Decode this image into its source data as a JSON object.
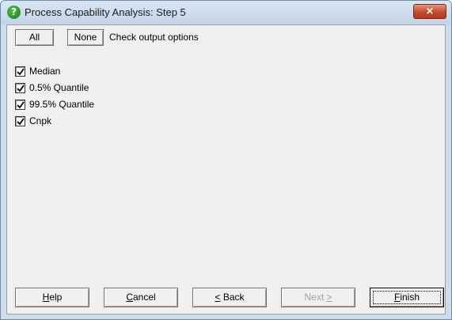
{
  "window": {
    "title": "Process Capability Analysis: Step 5",
    "close_label": "×"
  },
  "toolbar": {
    "all_label": "All",
    "none_label": "None",
    "instruction": "Check output options"
  },
  "options": [
    {
      "label": "Median",
      "checked": true
    },
    {
      "label": "0.5% Quantile",
      "checked": true
    },
    {
      "label": "99.5% Quantile",
      "checked": true
    },
    {
      "label": "Cnpk",
      "checked": true
    }
  ],
  "footer": {
    "help": {
      "prefix": "",
      "key": "H",
      "rest": "elp"
    },
    "cancel": {
      "prefix": "",
      "key": "C",
      "rest": "ancel"
    },
    "back": {
      "prefix": "",
      "key": "<",
      "rest": " Back"
    },
    "next": {
      "prefix": "Next ",
      "key": ">",
      "rest": ""
    },
    "finish": {
      "prefix": "",
      "key": "F",
      "rest": "inish"
    }
  }
}
